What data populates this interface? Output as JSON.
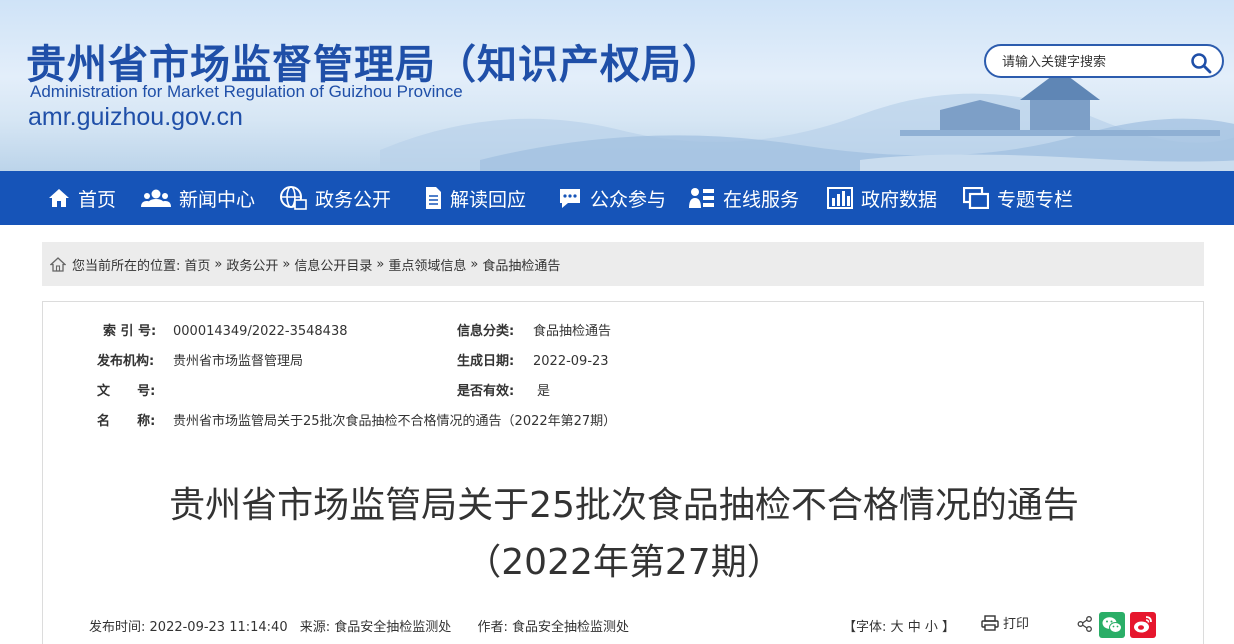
{
  "header": {
    "title_cn": "贵州省市场监督管理局（知识产权局）",
    "title_en": "Administration for Market Regulation of Guizhou Province",
    "domain": "amr.guizhou.gov.cn",
    "search_placeholder": "请输入关键字搜索"
  },
  "nav": {
    "items": [
      {
        "label": "首页",
        "icon": "home-icon"
      },
      {
        "label": "新闻中心",
        "icon": "people-icon"
      },
      {
        "label": "政务公开",
        "icon": "globe-icon"
      },
      {
        "label": "解读回应",
        "icon": "document-icon"
      },
      {
        "label": "公众参与",
        "icon": "chat-icon"
      },
      {
        "label": "在线服务",
        "icon": "service-icon"
      },
      {
        "label": "政府数据",
        "icon": "bar-chart-icon"
      },
      {
        "label": "专题专栏",
        "icon": "window-icon"
      }
    ]
  },
  "breadcrumb": {
    "prefix": "您当前所在的位置:",
    "items": [
      "首页",
      "政务公开",
      "信息公开目录",
      "重点领域信息",
      "食品抽检通告"
    ],
    "separator": "»"
  },
  "meta": {
    "index_label": "索 引 号:",
    "index_value": "000014349/2022-3548438",
    "category_label": "信息分类:",
    "category_value": "食品抽检通告",
    "publisher_label": "发布机构:",
    "publisher_value": "贵州省市场监督管理局",
    "date_label": "生成日期:",
    "date_value": "2022-09-23",
    "docno_label": "文      号:",
    "docno_value": "",
    "valid_label": "是否有效:",
    "valid_value": "是",
    "name_label": "名      称:",
    "name_value": "贵州省市场监管局关于25批次食品抽检不合格情况的通告（2022年第27期）"
  },
  "article": {
    "title_line1": "贵州省市场监管局关于25批次食品抽检不合格情况的通告",
    "title_line2": "（2022年第27期）"
  },
  "pubinfo": {
    "time_label": "发布时间:",
    "time_value": "2022-09-23 11:14:40",
    "source_label": "来源:",
    "source_value": "食品安全抽检监测处",
    "author_label": "作者:",
    "author_value": "食品安全抽检监测处",
    "font_label": "【字体:",
    "font_large": "大",
    "font_medium": "中",
    "font_small": "小",
    "font_end": "】",
    "print_label": "打印"
  },
  "colors": {
    "brand_blue": "#1654b8",
    "title_blue": "#1f4fa8",
    "wechat_green": "#2aae67",
    "weibo_red": "#e6162d"
  }
}
